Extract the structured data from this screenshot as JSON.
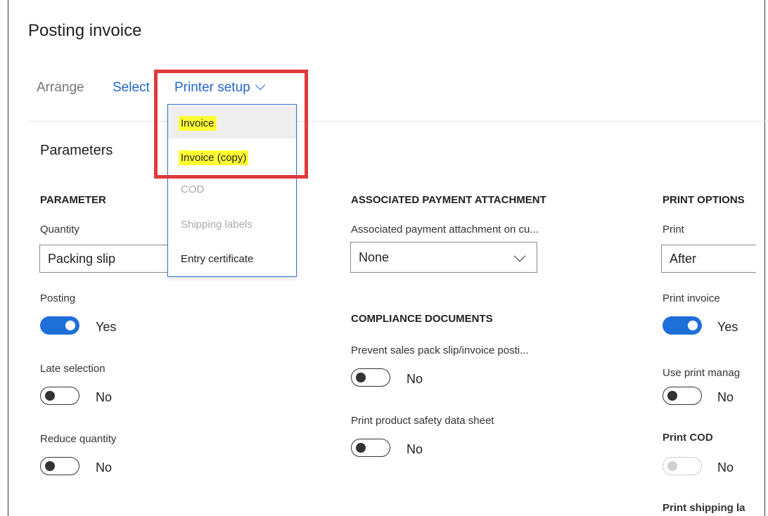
{
  "title": "Posting invoice",
  "toolbar": {
    "arrange": "Arrange",
    "select": "Select",
    "printer_setup": "Printer setup"
  },
  "section": "Parameters",
  "parameter": {
    "heading": "PARAMETER",
    "quantity_label": "Quantity",
    "quantity_value": "Packing slip",
    "posting_label": "Posting",
    "posting_value": "Yes",
    "late_label": "Late selection",
    "late_value": "No",
    "reduce_label": "Reduce quantity",
    "reduce_value": "No"
  },
  "printer_menu": {
    "items": [
      "Invoice",
      "Invoice (copy)",
      "COD",
      "Shipping labels",
      "Entry certificate"
    ]
  },
  "associated": {
    "heading": "ASSOCIATED PAYMENT ATTACHMENT",
    "label": "Associated payment attachment on cu...",
    "value": "None"
  },
  "compliance": {
    "heading": "COMPLIANCE DOCUMENTS",
    "prevent_label": "Prevent sales pack slip/invoice posti...",
    "prevent_value": "No",
    "safety_label": "Print product safety data sheet",
    "safety_value": "No"
  },
  "print_options": {
    "heading": "PRINT OPTIONS",
    "print_label": "Print",
    "print_value": "After",
    "print_invoice_label": "Print invoice",
    "print_invoice_value": "Yes",
    "use_print_label": "Use print manag",
    "use_print_value": "No",
    "print_cod_label": "Print COD",
    "print_cod_value": "No",
    "shipping_label": "Print shipping la"
  },
  "colors": {
    "accent": "#1f6fd8",
    "highlight": "#ffff33",
    "annotation": "#e03a3a"
  }
}
